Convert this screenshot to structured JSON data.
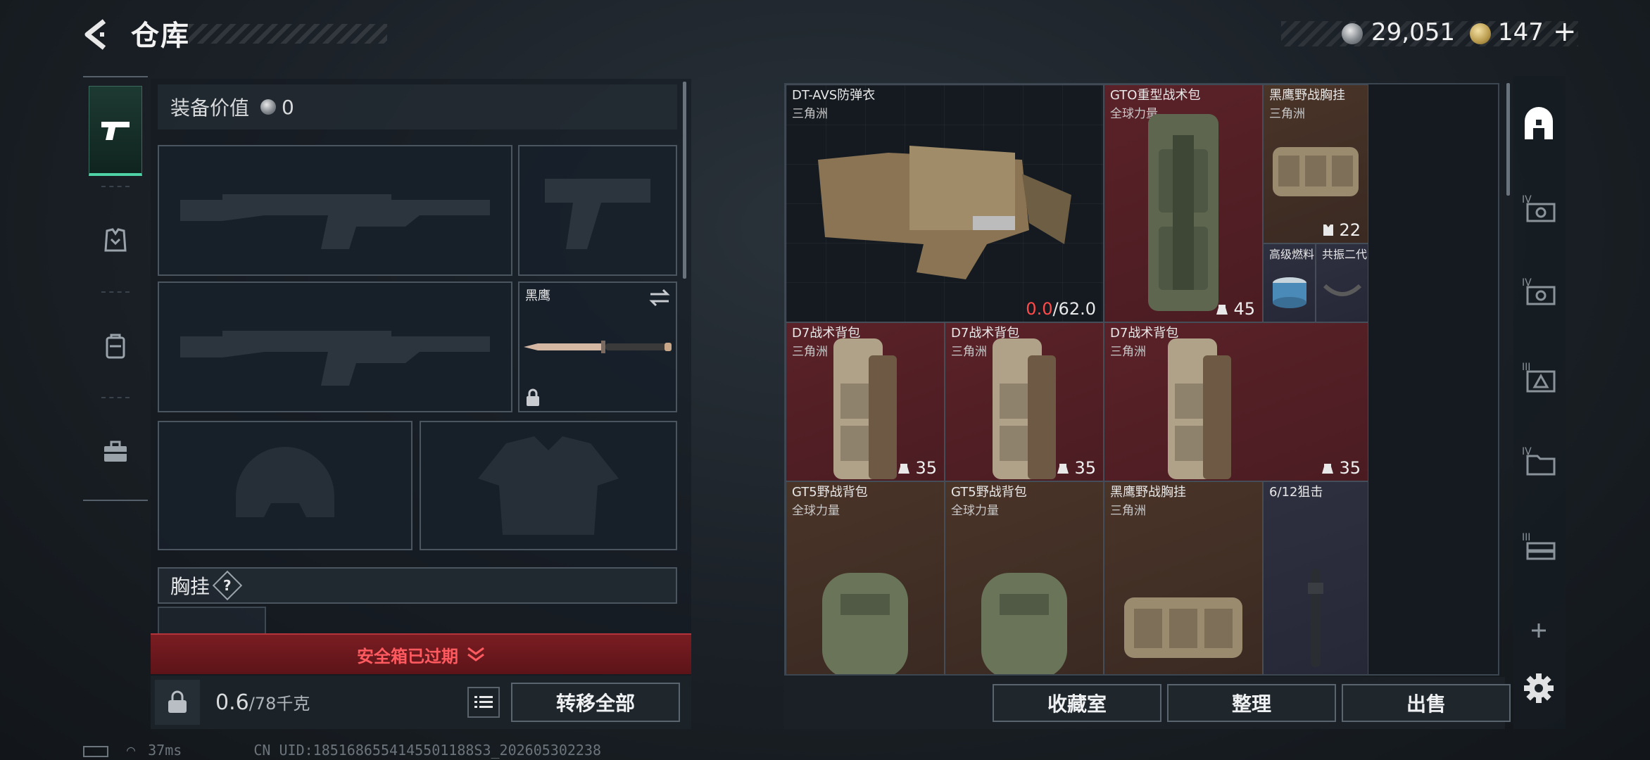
{
  "header": {
    "title": "仓库"
  },
  "currency": {
    "silver_value": "29,051",
    "gold_value": "147",
    "plus": "+"
  },
  "equipment": {
    "value_label": "装备价值",
    "value": "0",
    "melee_name": "黑鹰",
    "chest_rig_label": "胸挂",
    "help": "?"
  },
  "safebox": {
    "label": "安全箱已过期"
  },
  "weight": {
    "current": "0.6",
    "max": "/78千克"
  },
  "buttons": {
    "transfer_all": "转移全部",
    "collection": "收藏室",
    "sort": "整理",
    "sell": "出售"
  },
  "items": [
    {
      "name": "DT-AVS防弹衣",
      "sub": "三角洲",
      "durability_current": "0.0",
      "durability_max": "/62.0"
    },
    {
      "name": "GTO重型战术包",
      "sub": "全球力量",
      "count": "45"
    },
    {
      "name": "黑鹰野战胸挂",
      "sub": "三角洲",
      "count": "22"
    },
    {
      "name": "高级燃料",
      "sub": ""
    },
    {
      "name": "共振二代",
      "sub": ""
    },
    {
      "name": "D7战术背包",
      "sub": "三角洲",
      "count": "35"
    },
    {
      "name": "D7战术背包",
      "sub": "三角洲",
      "count": "35"
    },
    {
      "name": "D7战术背包",
      "sub": "三角洲",
      "count": "35"
    },
    {
      "name": "GT5野战背包",
      "sub": "全球力量"
    },
    {
      "name": "GT5野战背包",
      "sub": "全球力量"
    },
    {
      "name": "黑鹰野战胸挂",
      "sub": "三角洲"
    },
    {
      "name": "6/12狙击",
      "sub": ""
    }
  ],
  "status": {
    "ping": "37ms",
    "uid": "CN UID:1851686554145501188S3_202605302238"
  },
  "colors": {
    "accent": "#4fd3a6",
    "danger": "#ff5a60",
    "red_cell": "#5a2228",
    "blue_cell": "#2e3040",
    "brown_cell": "#4a3428"
  }
}
